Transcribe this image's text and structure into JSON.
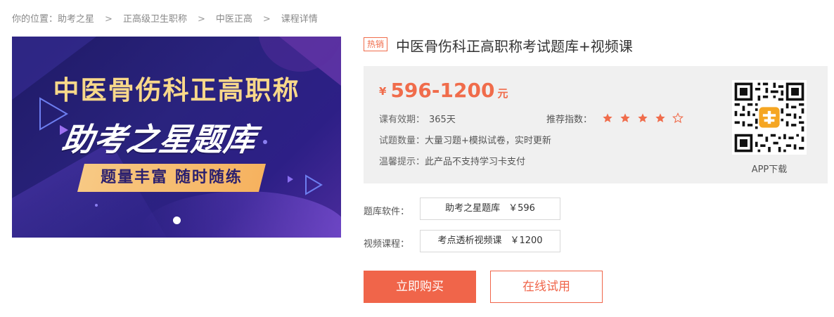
{
  "breadcrumb": {
    "prefix": "你的位置：",
    "items": [
      "助考之星",
      "正高级卫生职称",
      "中医正高",
      "课程详情"
    ],
    "separator": ">"
  },
  "banner": {
    "title": "中医骨伤科正高职称",
    "subtitle": "助考之星题库",
    "slogan": "题量丰富 随时随练",
    "colors": {
      "bg": "#2a237e",
      "title": "#f8d88a",
      "slogan_bg": "#f6b25f"
    }
  },
  "product": {
    "badge": "热销",
    "title": "中医骨伤科正高职称考试题库+视频课"
  },
  "price": {
    "currency": "¥",
    "range": "596-1200",
    "unit": "元",
    "color": "#f06c4b"
  },
  "details": {
    "validity_label": "课有效期：",
    "validity_value": "365天",
    "rating_label": "推荐指数：",
    "rating_value": 4,
    "rating_max": 5,
    "questions_label": "试题数量：",
    "questions_value": "大量习题+模拟试卷，实时更新",
    "tip_label": "温馨提示：",
    "tip_value": "此产品不支持学习卡支付"
  },
  "app": {
    "qr_icon": "qr-code-icon",
    "caption": "APP下载"
  },
  "options": [
    {
      "label": "题库软件：",
      "name": "助考之星题库",
      "price": "￥596"
    },
    {
      "label": "视频课程：",
      "name": "考点透析视频课",
      "price": "￥1200"
    }
  ],
  "actions": {
    "buy_label": "立即购买",
    "trial_label": "在线试用",
    "accent": "#f0654a"
  }
}
